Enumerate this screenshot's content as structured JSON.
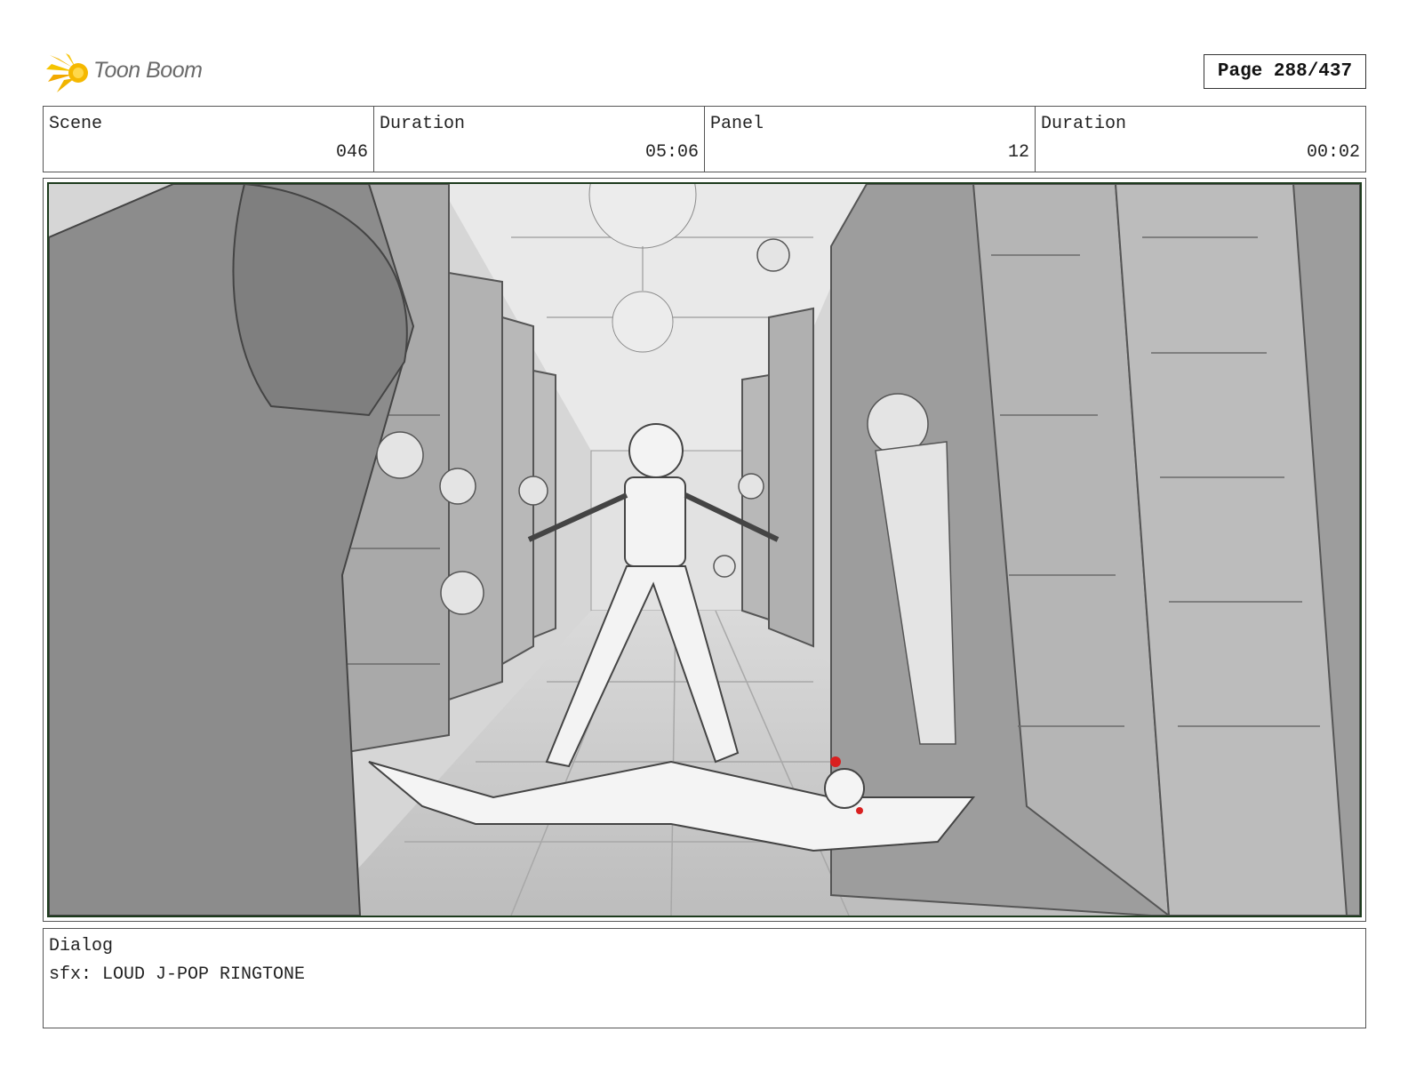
{
  "brand": {
    "name": "Toon Boom",
    "accent": "#f2b705"
  },
  "page": {
    "label": "Page 288/437"
  },
  "info": {
    "scene_label": "Scene",
    "scene_value": "046",
    "scene_duration_label": "Duration",
    "scene_duration_value": "05:06",
    "panel_label": "Panel",
    "panel_value": "12",
    "panel_duration_label": "Duration",
    "panel_duration_value": "00:02"
  },
  "frame": {
    "border_color": "#1d3b1d"
  },
  "dialog": {
    "label": "Dialog",
    "text": "sfx: LOUD J-POP RINGTONE"
  }
}
